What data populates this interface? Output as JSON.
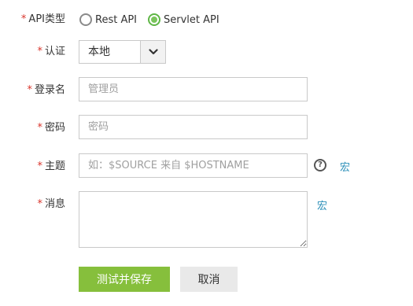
{
  "form": {
    "api_type": {
      "label": "API类型",
      "options": [
        {
          "label": "Rest API",
          "checked": false
        },
        {
          "label": "Servlet API",
          "checked": true
        }
      ]
    },
    "auth": {
      "label": "认证",
      "selected": "本地"
    },
    "login": {
      "label": "登录名",
      "placeholder": "管理员",
      "value": ""
    },
    "password": {
      "label": "密码",
      "placeholder": "密码",
      "value": ""
    },
    "subject": {
      "label": "主题",
      "placeholder": "如：$SOURCE 来自 $HOSTNAME",
      "value": "",
      "help_icon": "question-circle-icon",
      "macro_link": "宏"
    },
    "message": {
      "label": "消息",
      "value": "",
      "macro_link": "宏"
    },
    "required_mark": "*"
  },
  "actions": {
    "test_save_label": "测试并保存",
    "cancel_label": "取消"
  },
  "colors": {
    "required": "#d9342b",
    "radio_checked": "#7ac55c",
    "primary_button": "#86bf3c",
    "link": "#2b8fb8"
  }
}
